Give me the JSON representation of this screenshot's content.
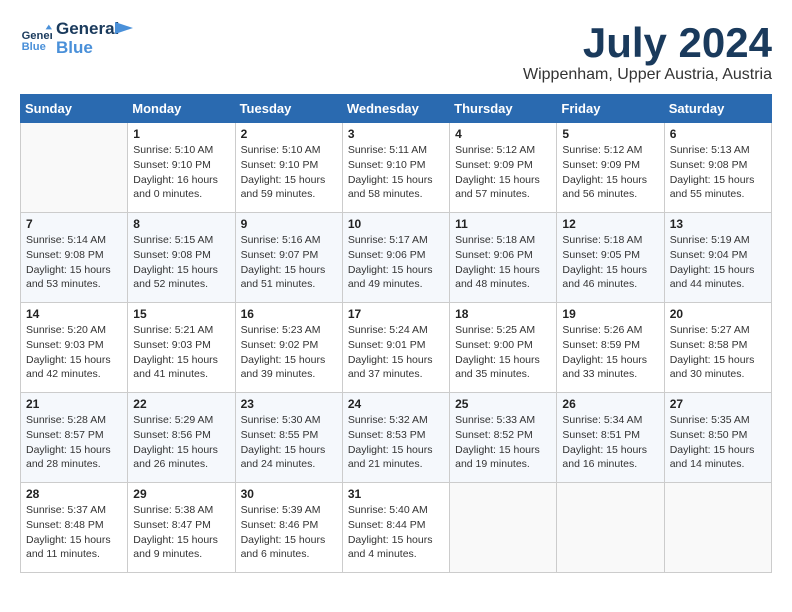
{
  "logo": {
    "text1": "General",
    "text2": "Blue"
  },
  "title": "July 2024",
  "location": "Wippenham, Upper Austria, Austria",
  "weekdays": [
    "Sunday",
    "Monday",
    "Tuesday",
    "Wednesday",
    "Thursday",
    "Friday",
    "Saturday"
  ],
  "weeks": [
    [
      {
        "day": "",
        "info": ""
      },
      {
        "day": "1",
        "info": "Sunrise: 5:10 AM\nSunset: 9:10 PM\nDaylight: 16 hours\nand 0 minutes."
      },
      {
        "day": "2",
        "info": "Sunrise: 5:10 AM\nSunset: 9:10 PM\nDaylight: 15 hours\nand 59 minutes."
      },
      {
        "day": "3",
        "info": "Sunrise: 5:11 AM\nSunset: 9:10 PM\nDaylight: 15 hours\nand 58 minutes."
      },
      {
        "day": "4",
        "info": "Sunrise: 5:12 AM\nSunset: 9:09 PM\nDaylight: 15 hours\nand 57 minutes."
      },
      {
        "day": "5",
        "info": "Sunrise: 5:12 AM\nSunset: 9:09 PM\nDaylight: 15 hours\nand 56 minutes."
      },
      {
        "day": "6",
        "info": "Sunrise: 5:13 AM\nSunset: 9:08 PM\nDaylight: 15 hours\nand 55 minutes."
      }
    ],
    [
      {
        "day": "7",
        "info": "Sunrise: 5:14 AM\nSunset: 9:08 PM\nDaylight: 15 hours\nand 53 minutes."
      },
      {
        "day": "8",
        "info": "Sunrise: 5:15 AM\nSunset: 9:08 PM\nDaylight: 15 hours\nand 52 minutes."
      },
      {
        "day": "9",
        "info": "Sunrise: 5:16 AM\nSunset: 9:07 PM\nDaylight: 15 hours\nand 51 minutes."
      },
      {
        "day": "10",
        "info": "Sunrise: 5:17 AM\nSunset: 9:06 PM\nDaylight: 15 hours\nand 49 minutes."
      },
      {
        "day": "11",
        "info": "Sunrise: 5:18 AM\nSunset: 9:06 PM\nDaylight: 15 hours\nand 48 minutes."
      },
      {
        "day": "12",
        "info": "Sunrise: 5:18 AM\nSunset: 9:05 PM\nDaylight: 15 hours\nand 46 minutes."
      },
      {
        "day": "13",
        "info": "Sunrise: 5:19 AM\nSunset: 9:04 PM\nDaylight: 15 hours\nand 44 minutes."
      }
    ],
    [
      {
        "day": "14",
        "info": "Sunrise: 5:20 AM\nSunset: 9:03 PM\nDaylight: 15 hours\nand 42 minutes."
      },
      {
        "day": "15",
        "info": "Sunrise: 5:21 AM\nSunset: 9:03 PM\nDaylight: 15 hours\nand 41 minutes."
      },
      {
        "day": "16",
        "info": "Sunrise: 5:23 AM\nSunset: 9:02 PM\nDaylight: 15 hours\nand 39 minutes."
      },
      {
        "day": "17",
        "info": "Sunrise: 5:24 AM\nSunset: 9:01 PM\nDaylight: 15 hours\nand 37 minutes."
      },
      {
        "day": "18",
        "info": "Sunrise: 5:25 AM\nSunset: 9:00 PM\nDaylight: 15 hours\nand 35 minutes."
      },
      {
        "day": "19",
        "info": "Sunrise: 5:26 AM\nSunset: 8:59 PM\nDaylight: 15 hours\nand 33 minutes."
      },
      {
        "day": "20",
        "info": "Sunrise: 5:27 AM\nSunset: 8:58 PM\nDaylight: 15 hours\nand 30 minutes."
      }
    ],
    [
      {
        "day": "21",
        "info": "Sunrise: 5:28 AM\nSunset: 8:57 PM\nDaylight: 15 hours\nand 28 minutes."
      },
      {
        "day": "22",
        "info": "Sunrise: 5:29 AM\nSunset: 8:56 PM\nDaylight: 15 hours\nand 26 minutes."
      },
      {
        "day": "23",
        "info": "Sunrise: 5:30 AM\nSunset: 8:55 PM\nDaylight: 15 hours\nand 24 minutes."
      },
      {
        "day": "24",
        "info": "Sunrise: 5:32 AM\nSunset: 8:53 PM\nDaylight: 15 hours\nand 21 minutes."
      },
      {
        "day": "25",
        "info": "Sunrise: 5:33 AM\nSunset: 8:52 PM\nDaylight: 15 hours\nand 19 minutes."
      },
      {
        "day": "26",
        "info": "Sunrise: 5:34 AM\nSunset: 8:51 PM\nDaylight: 15 hours\nand 16 minutes."
      },
      {
        "day": "27",
        "info": "Sunrise: 5:35 AM\nSunset: 8:50 PM\nDaylight: 15 hours\nand 14 minutes."
      }
    ],
    [
      {
        "day": "28",
        "info": "Sunrise: 5:37 AM\nSunset: 8:48 PM\nDaylight: 15 hours\nand 11 minutes."
      },
      {
        "day": "29",
        "info": "Sunrise: 5:38 AM\nSunset: 8:47 PM\nDaylight: 15 hours\nand 9 minutes."
      },
      {
        "day": "30",
        "info": "Sunrise: 5:39 AM\nSunset: 8:46 PM\nDaylight: 15 hours\nand 6 minutes."
      },
      {
        "day": "31",
        "info": "Sunrise: 5:40 AM\nSunset: 8:44 PM\nDaylight: 15 hours\nand 4 minutes."
      },
      {
        "day": "",
        "info": ""
      },
      {
        "day": "",
        "info": ""
      },
      {
        "day": "",
        "info": ""
      }
    ]
  ]
}
